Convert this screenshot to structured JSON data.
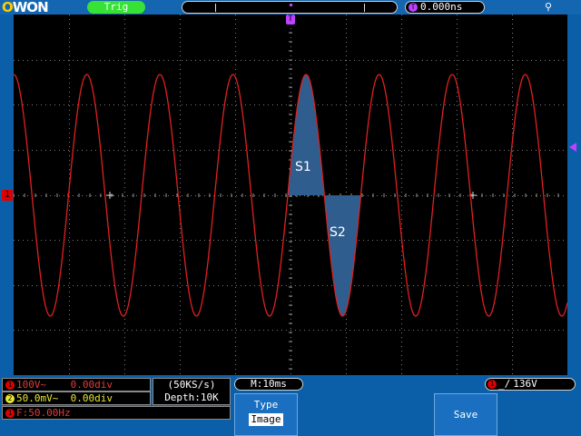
{
  "header": {
    "logo": "OWON",
    "trigger_status": "Trig",
    "time_offset": "0.000ns",
    "time_offset_badge": "T"
  },
  "screen": {
    "ch1_marker": "1",
    "trigger_pos_marker": "T",
    "area_labels": [
      "S1",
      "S2"
    ]
  },
  "channels": {
    "ch1": {
      "badge": "1",
      "text": "100V~    0.00div",
      "color": "#e43a3a"
    },
    "ch2": {
      "badge": "2",
      "text": "50.0mV~  0.00div",
      "color": "#e8e830"
    }
  },
  "acquisition": {
    "sample_rate": "(50KS/s)",
    "depth": "Depth:10K"
  },
  "frequency": {
    "badge": "1",
    "text": "F:50.00Hz"
  },
  "timebase": "M:10ms",
  "trigger": {
    "badge": "1",
    "edge_icon": "rising-edge-icon",
    "level": "136V"
  },
  "softkeys": {
    "type_label": "Type",
    "type_value": "Image",
    "save_label": "Save"
  },
  "colors": {
    "trace": "#e02020",
    "fill": "#2f5d8e",
    "background": "#0a5fa8"
  }
}
